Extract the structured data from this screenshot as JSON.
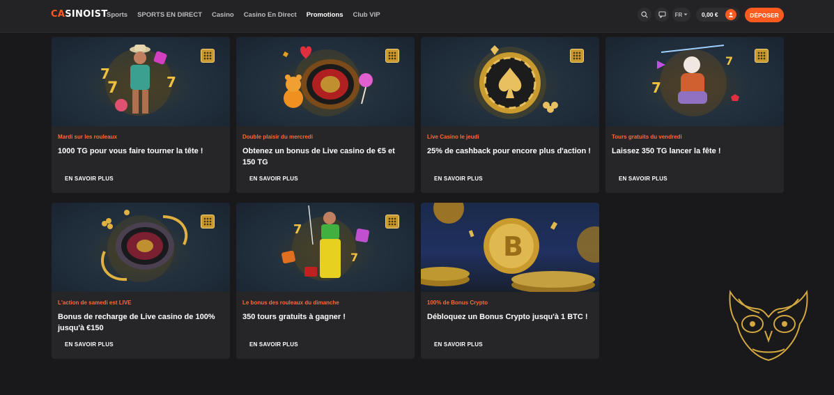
{
  "header": {
    "logo_prefix": "CA",
    "logo_rest": "SINOIST",
    "nav": [
      "Sports",
      "SPORTS EN DIRECT",
      "Casino",
      "Casino En Direct",
      "Promotions",
      "Club VIP"
    ],
    "active_nav": "Promotions",
    "language": "FR",
    "balance": "0,00 €",
    "deposit_label": "DÉPOSER"
  },
  "colors": {
    "accent": "#ff5a1f",
    "category": "#ff6a3a",
    "card_bg": "#262628",
    "page_bg": "#19191b"
  },
  "promotions": [
    {
      "category": "Mardi sur les rouleaux",
      "title": "1000 TG pour vous faire tourner la tête !",
      "more": "EN SAVOIR PLUS",
      "art": "cowboy-slot"
    },
    {
      "category": "Double plaisir du mercredi",
      "title": "Obtenez un bonus de Live casino de €5 et 150 TG",
      "more": "EN SAVOIR PLUS",
      "art": "roulette-bear"
    },
    {
      "category": "Live Casino le jeudi",
      "title": "25% de cashback pour encore plus d'action !",
      "more": "EN SAVOIR PLUS",
      "art": "spade-chip"
    },
    {
      "category": "Tours gratuits du vendredi",
      "title": "Laissez 350 TG lancer la fête !",
      "more": "EN SAVOIR PLUS",
      "art": "zeus-slot"
    },
    {
      "category": "L'action de samedi est LIVE",
      "title": "Bonus de recharge de Live casino de 100% jusqu'à €150",
      "more": "EN SAVOIR PLUS",
      "art": "roulette-wheel"
    },
    {
      "category": "Le bonus des rouleaux du dimanche",
      "title": "350 tours gratuits à gagner !",
      "more": "EN SAVOIR PLUS",
      "art": "fisherman-slot"
    },
    {
      "category": "100% de Bonus Crypto",
      "title": "Débloquez un Bonus Crypto jusqu'à 1 BTC !",
      "more": "EN SAVOIR PLUS",
      "art": "bitcoin-coins"
    }
  ]
}
